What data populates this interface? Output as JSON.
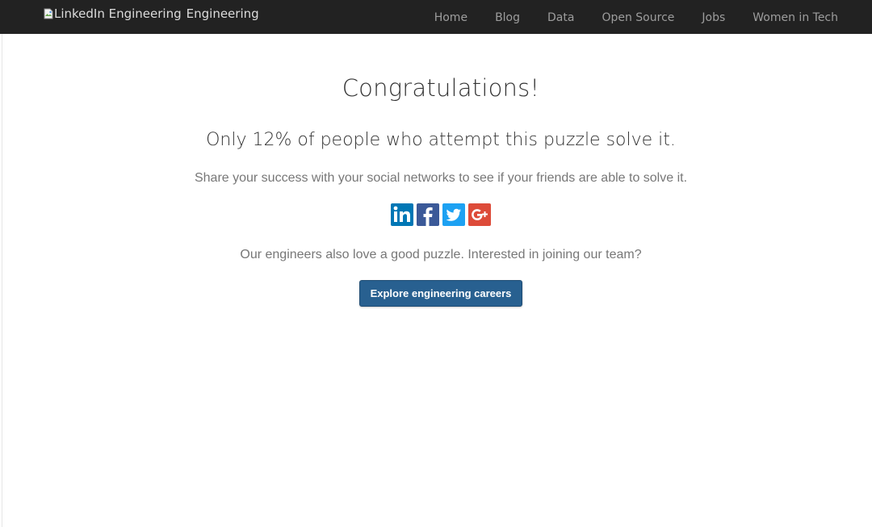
{
  "navbar": {
    "brand_image_alt": "LinkedIn Engineering",
    "brand_text": "Engineering",
    "links": [
      "Home",
      "Blog",
      "Data",
      "Open Source",
      "Jobs",
      "Women in Tech"
    ]
  },
  "main": {
    "heading": "Congratulations!",
    "subheading": "Only 12% of people who attempt this puzzle solve it.",
    "share_text": "Share your success with your social networks to see if your friends are able to solve it.",
    "social_icons": [
      "linkedin-icon",
      "facebook-icon",
      "twitter-icon",
      "google-plus-icon"
    ],
    "careers_text": "Our engineers also love a good puzzle. Interested in joining our team?",
    "careers_button": "Explore engineering careers"
  },
  "colors": {
    "navbar_bg": "#222222",
    "button_bg": "#286090",
    "linkedin": "#0077b5",
    "facebook": "#3b5998",
    "twitter": "#1da1f2",
    "google_plus": "#dd4b39"
  }
}
